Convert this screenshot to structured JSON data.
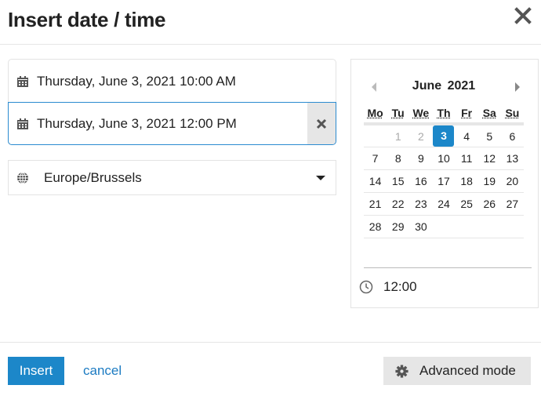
{
  "dialog": {
    "title": "Insert date / time",
    "close_icon": "close-icon"
  },
  "dates": {
    "start": {
      "value": "Thursday, June 3, 2021 10:00 AM",
      "icon": "calendar-icon"
    },
    "end": {
      "value": "Thursday, June 3, 2021 12:00 PM",
      "icon": "calendar-icon",
      "clear_icon": "clear-icon"
    }
  },
  "timezone": {
    "value": "Europe/Brussels",
    "icon": "globe-icon"
  },
  "calendar": {
    "month_label": "June 2021",
    "weekdays": [
      "Mo",
      "Tu",
      "We",
      "Th",
      "Fr",
      "Sa",
      "Su"
    ],
    "weeks": [
      [
        "",
        "1",
        "2",
        "3",
        "4",
        "5",
        "6"
      ],
      [
        "7",
        "8",
        "9",
        "10",
        "11",
        "12",
        "13"
      ],
      [
        "14",
        "15",
        "16",
        "17",
        "18",
        "19",
        "20"
      ],
      [
        "21",
        "22",
        "23",
        "24",
        "25",
        "26",
        "27"
      ],
      [
        "28",
        "29",
        "30",
        "",
        "",
        "",
        ""
      ]
    ],
    "selected_day": "3",
    "past_days": [
      "1",
      "2"
    ],
    "time": "12:00",
    "time_icon": "clock-icon"
  },
  "footer": {
    "insert_label": "Insert",
    "cancel_label": "cancel",
    "advanced_label": "Advanced mode",
    "advanced_icon": "gear-icon"
  },
  "colors": {
    "accent": "#1c87c9",
    "link": "#1c7bc2",
    "active_border": "#2b8bd0",
    "button_gray": "#e6e6e6"
  }
}
